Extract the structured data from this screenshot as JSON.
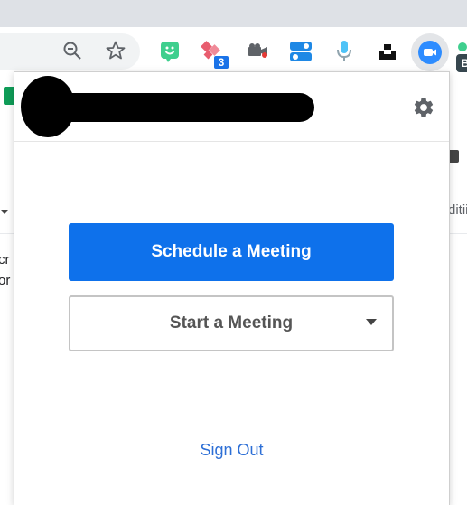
{
  "browser": {
    "extensions": [
      {
        "name": "zoom-out-icon"
      },
      {
        "name": "bookmark-star-icon"
      },
      {
        "name": "bitmoji-icon"
      },
      {
        "name": "extension-badge-icon",
        "badge": "3"
      },
      {
        "name": "screen-recorder-icon"
      },
      {
        "name": "toggle-switch-icon"
      },
      {
        "name": "microphone-icon"
      },
      {
        "name": "unsplash-icon"
      },
      {
        "name": "zoom-camera-icon"
      },
      {
        "name": "profile-icon",
        "label": "B"
      }
    ]
  },
  "page_background": {
    "fragments": [
      "cr",
      "or c",
      "ditii"
    ]
  },
  "popup": {
    "header": {
      "user_name_redacted": true
    },
    "schedule_button": "Schedule a Meeting",
    "start_button": "Start a Meeting",
    "sign_out_link": "Sign Out"
  },
  "colors": {
    "primary": "#0e71eb",
    "link": "#2d6fd6",
    "tabstrip": "#dee1e6"
  }
}
